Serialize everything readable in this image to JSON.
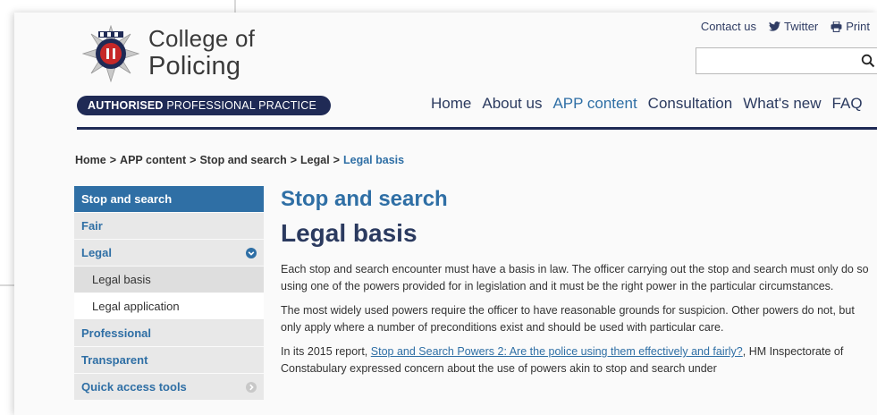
{
  "header": {
    "brand_line_1": "College of",
    "brand_line_2": "Policing",
    "badge_bold": "AUTHORISED",
    "badge_rest": " PROFESSIONAL PRACTICE",
    "top_links": [
      {
        "label": "Contact us",
        "icon": "none"
      },
      {
        "label": "Twitter",
        "icon": "twitter-icon"
      },
      {
        "label": "Print",
        "icon": "print-icon"
      }
    ],
    "search": {
      "placeholder": "",
      "value": "",
      "icon": "search-icon"
    },
    "nav": [
      {
        "label": "Home",
        "active": false
      },
      {
        "label": "About us",
        "active": false
      },
      {
        "label": "APP content",
        "active": true
      },
      {
        "label": "Consultation",
        "active": false
      },
      {
        "label": "What's new",
        "active": false
      },
      {
        "label": "FAQ",
        "active": false
      }
    ]
  },
  "breadcrumb": {
    "items": [
      "Home",
      "APP content",
      "Stop and search",
      "Legal"
    ],
    "current": "Legal basis",
    "separator": ">"
  },
  "sidebar": {
    "items": [
      {
        "label": "Stop and search",
        "kind": "head"
      },
      {
        "label": "Fair",
        "kind": "item"
      },
      {
        "label": "Legal",
        "kind": "item-expanded"
      },
      {
        "label": "Legal basis",
        "kind": "sub-selected"
      },
      {
        "label": "Legal application",
        "kind": "sub"
      },
      {
        "label": "Professional",
        "kind": "item"
      },
      {
        "label": "Transparent",
        "kind": "item"
      },
      {
        "label": "Quick access tools",
        "kind": "item-collapsed"
      }
    ]
  },
  "content": {
    "section_title": "Stop and search",
    "page_title": "Legal basis",
    "paragraph_1": "Each stop and search encounter must have a basis in law. The officer carrying out the stop and search must only do so using one of the powers provided for in legislation and it must be the right power in the particular circumstances.",
    "paragraph_2": "The most widely used powers require the officer to have reasonable grounds for suspicion. Other powers do not, but only apply where a number of preconditions exist and should be used with particular care.",
    "paragraph_3_prefix": "In its 2015 report, ",
    "paragraph_3_link": "Stop and Search Powers 2: Are the police using them effectively and fairly?",
    "paragraph_3_suffix": ", HM Inspectorate of Constabulary expressed concern about the use of powers akin to stop and search under"
  },
  "colors": {
    "brand_navy": "#1f2a55",
    "link_blue": "#2f6fa5",
    "sidebar_grey": "#e8e8e8"
  }
}
